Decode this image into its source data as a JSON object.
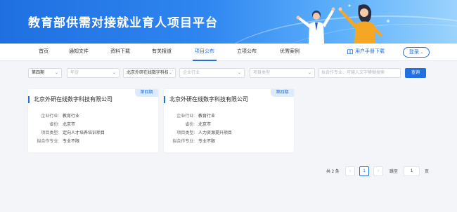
{
  "banner": {
    "title": "教育部供需对接就业育人项目平台"
  },
  "nav": {
    "items": [
      "首页",
      "通知文件",
      "资料下载",
      "有关报道",
      "项目公布",
      "立项公布",
      "优秀案例"
    ],
    "active": "项目公布",
    "manual_label": "用户手册下载",
    "login_label": "登录"
  },
  "filters": {
    "period": "第四期",
    "year_placeholder": "年份",
    "province_placeholder": "省份",
    "company": "北京外研在线数字科技有",
    "industry_placeholder": "企业行业",
    "type_placeholder": "项目类型",
    "search_placeholder": "拟合作专业、可输入文字模糊搜索",
    "query_label": "查询"
  },
  "card_labels": {
    "industry": "企业行业:",
    "province": "省份:",
    "type": "项目类型:",
    "major": "拟合作专业:"
  },
  "cards": [
    {
      "badge": "第四期",
      "company": "北京外研在线数字科技有限公司",
      "industry": "教育行业",
      "province": "北京市",
      "type": "定向人才培养培训项目",
      "major": "专业不限"
    },
    {
      "badge": "第四期",
      "company": "北京外研在线数字科技有限公司",
      "industry": "教育行业",
      "province": "北京市",
      "type": "人力资源提升项目",
      "major": "专业不限"
    }
  ],
  "pagination": {
    "total": "共 2 条",
    "prev": "‹",
    "current_page": "1",
    "next": "›",
    "jump_label": "跳至",
    "jump_value": "1",
    "page_suffix": "页"
  },
  "colors": {
    "primary": "#1f6fe0",
    "badge_bg": "#dcebff",
    "page_bg": "#f3f5f9"
  }
}
